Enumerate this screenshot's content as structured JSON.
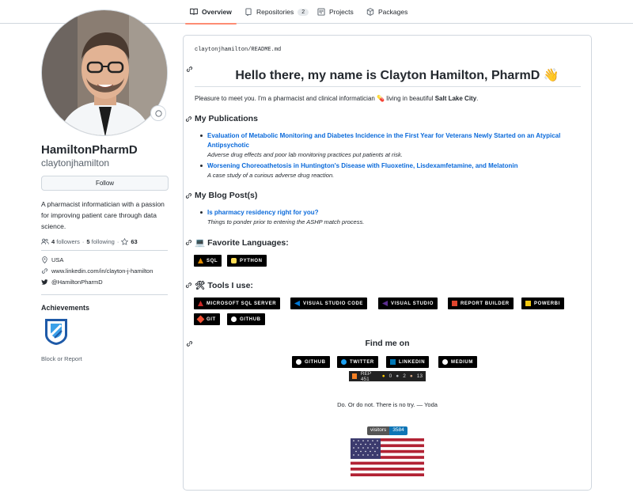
{
  "nav": {
    "tabs": [
      {
        "label": "Overview",
        "icon": "book-icon"
      },
      {
        "label": "Repositories",
        "icon": "repo-icon",
        "count": "2"
      },
      {
        "label": "Projects",
        "icon": "project-icon"
      },
      {
        "label": "Packages",
        "icon": "package-icon"
      }
    ]
  },
  "profile": {
    "name": "HamiltonPharmD",
    "login": "claytonjhamilton",
    "follow_label": "Follow",
    "bio": "A pharmacist informatician with a passion for improving patient care through data science.",
    "followers_count": "4",
    "followers_label": "followers",
    "following_count": "5",
    "following_label": "following",
    "stars_count": "63",
    "separator": "·",
    "location": "USA",
    "website": "www.linkedin.com/in/clayton-j-hamilton",
    "twitter": "@HamiltonPharmD",
    "achievements_title": "Achievements",
    "block_label": "Block or Report"
  },
  "readme": {
    "path_user": "claytonjhamilton",
    "path_sep": "/",
    "path_file": "README.md",
    "title": "Hello there, my name is Clayton Hamilton, PharmD",
    "title_emoji": "👋",
    "intro_prefix": "Pleasure to meet you. I'm a pharmacist and clinical informatician",
    "intro_emoji": "💊",
    "intro_mid": "living in beautiful",
    "intro_city": "Salt Lake City",
    "intro_end": ".",
    "publications_heading": "My Publications",
    "publications": [
      {
        "title": "Evaluation of Metabolic Monitoring and Diabetes Incidence in the First Year for Veterans Newly Started on an Atypical Antipsychotic",
        "desc": "Adverse drug effects and poor lab monitoring practices put patients at risk."
      },
      {
        "title": "Worsening Choreoathetosis in Huntington's Disease with Fluoxetine, Lisdexamfetamine, and Melatonin",
        "desc": "A case study of a curious adverse drug reaction."
      }
    ],
    "blog_heading": "My Blog Post(s)",
    "blog": [
      {
        "title": "Is pharmacy residency right for you?",
        "desc": "Things to ponder prior to entering the ASHP match process."
      }
    ],
    "languages_heading": "Favorite Languages:",
    "languages_emoji": "💻",
    "languages": [
      {
        "label": "SQL",
        "logo_color": "#e38c00"
      },
      {
        "label": "PYTHON",
        "logo_color": "#ffdd54"
      }
    ],
    "tools_heading": "Tools I use:",
    "tools_emoji": "🛠",
    "tools": [
      {
        "label": "MICROSOFT SQL SERVER",
        "logo_color": "#cc2927"
      },
      {
        "label": "VISUAL STUDIO CODE",
        "logo_color": "#0078d7"
      },
      {
        "label": "VISUAL STUDIO",
        "logo_color": "#5c2d91"
      },
      {
        "label": "REPORT BUILDER",
        "logo_color": "#e0452d"
      },
      {
        "label": "POWERBI",
        "logo_color": "#f2c811"
      },
      {
        "label": "GIT",
        "logo_color": "#f05033"
      },
      {
        "label": "GITHUB",
        "logo_color": "#ffffff"
      }
    ],
    "findme_heading": "Find me on",
    "socials": [
      {
        "label": "GITHUB",
        "logo_color": "#ffffff"
      },
      {
        "label": "TWITTER",
        "logo_color": "#1ca0f1"
      },
      {
        "label": "LINKEDIN",
        "logo_color": "#0077b5"
      },
      {
        "label": "MEDIUM",
        "logo_color": "#ffffff"
      }
    ],
    "rep_label": "REP 451",
    "rep_gold": "0",
    "rep_silver": "2",
    "rep_bronze": "13",
    "quote": "Do. Or do not. There is no try. — Yoda",
    "visitors_label": "visitors",
    "visitors_count": "3584"
  }
}
